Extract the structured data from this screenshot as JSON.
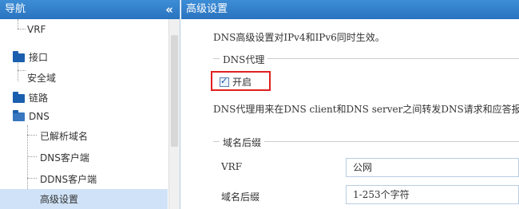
{
  "sidebar": {
    "title": "导航",
    "collapse_icon": "«",
    "items": [
      {
        "label": "VRF"
      },
      {
        "label": "接口"
      },
      {
        "label": "安全域"
      },
      {
        "label": "链路"
      },
      {
        "label": "DNS"
      },
      {
        "label": "已解析域名"
      },
      {
        "label": "DNS客户端"
      },
      {
        "label": "DDNS客户端"
      },
      {
        "label": "高级设置"
      }
    ]
  },
  "main": {
    "title": "高级设置",
    "note": "DNS高级设置对IPv4和IPv6同时生效。",
    "proxy_group": {
      "title": "DNS代理",
      "enable_label": "开启",
      "enabled": true,
      "description": "DNS代理用来在DNS client和DNS server之间转发DNS请求和应答报文。"
    },
    "suffix_group": {
      "title": "域名后缀",
      "vrf_label": "VRF",
      "vrf_value": "公网",
      "suffix_label": "域名后缀",
      "suffix_placeholder": "1-253个字符"
    }
  },
  "colors": {
    "header_blue": "#2a73bf",
    "folder_blue": "#1b5fae",
    "selected_bg": "#cfe2f7",
    "highlight_red": "#e02020"
  }
}
